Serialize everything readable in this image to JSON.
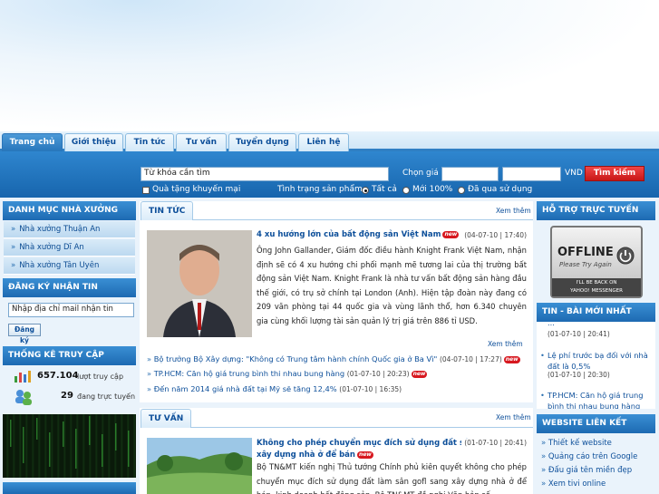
{
  "nav": {
    "tabs": [
      "Trang chủ",
      "Giới thiệu",
      "Tin tức",
      "Tư vấn",
      "Tuyển dụng",
      "Liên hệ"
    ]
  },
  "search": {
    "keyword_value": "Từ khóa cần tìm",
    "price_label": "Chọn giá",
    "currency": "VND",
    "button_label": "Tìm kiếm",
    "gift_label": "Quà tặng khuyến mại",
    "condition_label": "Tình trạng sản phẩm",
    "options": [
      "Tất cả",
      "Mới 100%",
      "Đã qua sử dụng"
    ],
    "selected_option": "Tất cả"
  },
  "left": {
    "category_title": "DANH MỤC NHÀ XƯỞNG",
    "categories": [
      "Nhà xưởng Thuận An",
      "Nhà xưởng Dĩ An",
      "Nhà xưởng Tân Uyên"
    ],
    "subscribe_title": "ĐĂNG KÝ NHẬN TIN",
    "subscribe_placeholder": "Nhập địa chỉ mail nhận tin",
    "subscribe_button": "Đăng ký",
    "stats_title": "THỐNG KÊ TRUY CẬP",
    "visits_value": "657.104",
    "visits_label": "lượt truy cập",
    "online_value": "29",
    "online_label": "đang trực tuyến"
  },
  "news": {
    "tab_label": "TIN TỨC",
    "more_label": "Xem thêm",
    "featured_title": "4 xu hướng lớn của bất động sản Việt Nam",
    "featured_date": "(04-07-10 | 17:40)",
    "featured_body": "Ông John Gallander, Giám đốc điều hành Knight Frank Việt Nam, nhận định sẽ có 4 xu hướng chi phối mạnh mẽ tương lai của thị trường bất động sản Việt Nam. Knight Frank là nhà tư vấn bất động sản hàng đầu thế giới, có trụ sở chính tại London (Anh). Hiện tập đoàn này đang có 209 văn phòng tại 44 quốc gia và vùng lãnh thổ, hơn 6.340 chuyên gia cùng khối lượng tài sản quản lý trị giá trên 886 tỉ USD.",
    "more_label_2": "Xem thêm",
    "items": [
      {
        "title": "Bộ trưởng Bộ Xây dựng: \"Không có Trung tâm hành chính Quốc gia ở Ba Vì\"",
        "date": "(04-07-10 | 17:27)",
        "is_new": true
      },
      {
        "title": "TP.HCM: Căn hộ giá trung bình thi nhau bung hàng",
        "date": "(01-07-10 | 20:23)",
        "is_new": true
      },
      {
        "title": "Đến năm 2014 giá nhà đất tại Mỹ sẽ tăng 12,4%",
        "date": "(01-07-10 | 16:35)",
        "is_new": false
      }
    ],
    "new_badge": "new"
  },
  "advice": {
    "tab_label": "TƯ VẤN",
    "more_label": "Xem thêm",
    "featured_title": "Không cho phép chuyển mục đích sử dụng đất sân gofl sang xây dựng nhà ở để bán",
    "featured_date": "(01-07-10 | 20:41)",
    "featured_body": "Bộ TN&MT kiến nghị Thủ tướng Chính phủ kiên quyết không cho phép chuyển mục đích sử dụng đất làm sân gofl sang xây dựng nhà ở để bán, kinh doanh bất động sản. Bộ TN&MT đề nghị Văn bản số"
  },
  "right": {
    "support_title": "HỖ TRỢ TRỰC TUYẾN",
    "offline_main": "OFFLINE",
    "offline_sub": "Please Try Again",
    "offline_foot1": "I'LL BE BACK ON",
    "offline_foot2": "YAHOO! MESSENGER",
    "latest_title": "TIN - BÀI MỚI NHẤT",
    "latest_items": [
      {
        "title": "...",
        "date": "(01-07-10 | 20:41)"
      },
      {
        "title": "Lệ phí trước bạ đối với nhà đất là 0,5%",
        "date": "(01-07-10 | 20:30)"
      },
      {
        "title": "TP.HCM: Căn hộ giá trung bình thi nhau bung hàng",
        "date": ""
      }
    ],
    "links_title": "WEBSITE LIÊN KẾT",
    "links": [
      "Thiết kế website",
      "Quảng cáo trên Google",
      "Đấu giá tên miền đẹp",
      "Xem tivi online"
    ]
  }
}
